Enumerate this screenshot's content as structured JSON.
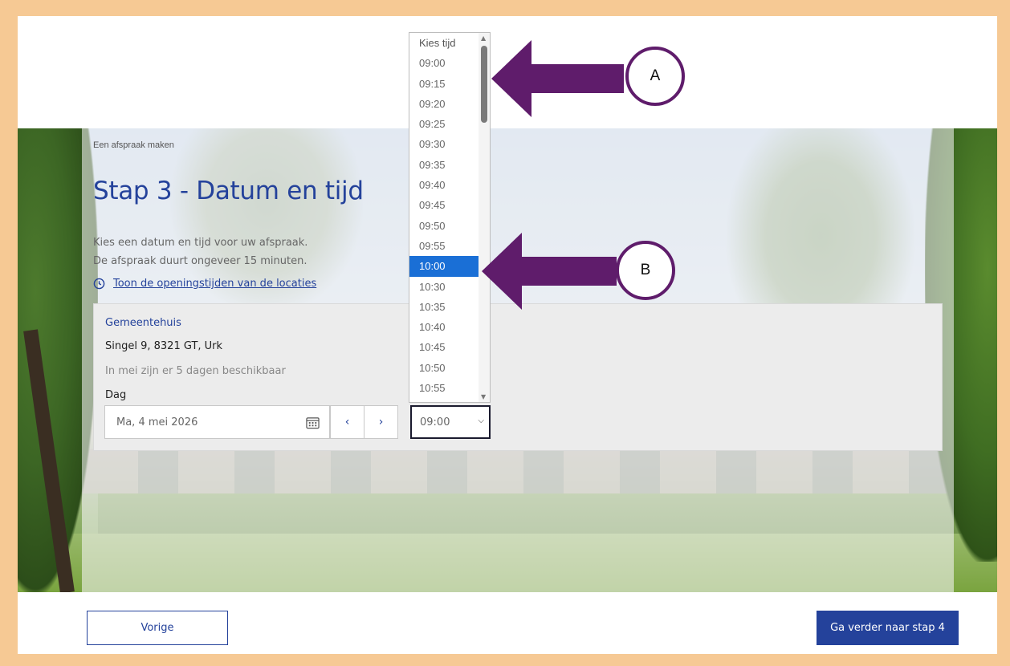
{
  "header": {
    "breadcrumb": "Een afspraak maken",
    "title": "Stap 3 - Datum en tijd",
    "intro_line1": "Kies een datum en tijd voor uw afspraak.",
    "intro_line2": "De afspraak duurt ongeveer 15 minuten.",
    "hours_link": "Toon de openingstijden van de locaties"
  },
  "location": {
    "name": "Gemeentehuis",
    "address": "Singel 9, 8321 GT, Urk",
    "availability": "In mei zijn er 5 dagen beschikbaar",
    "day_label": "Dag",
    "date_value": "Ma, 4 mei 2026",
    "prev_symbol": "‹",
    "next_symbol": "›"
  },
  "time_select": {
    "current_value": "09:00",
    "options": [
      "Kies tijd",
      "09:00",
      "09:15",
      "09:20",
      "09:25",
      "09:30",
      "09:35",
      "09:40",
      "09:45",
      "09:50",
      "09:55",
      "10:00",
      "10:30",
      "10:35",
      "10:40",
      "10:45",
      "10:50",
      "10:55"
    ],
    "highlighted": "10:00"
  },
  "footer": {
    "back_label": "Vorige",
    "next_label": "Ga verder naar stap 4"
  },
  "annotations": {
    "callout_a": "A",
    "callout_b": "B",
    "arrow_color": "#5f1c6b"
  },
  "colors": {
    "brand_blue": "#24429b",
    "highlight_blue": "#1a6fd6",
    "frame_border": "#f6c994"
  }
}
